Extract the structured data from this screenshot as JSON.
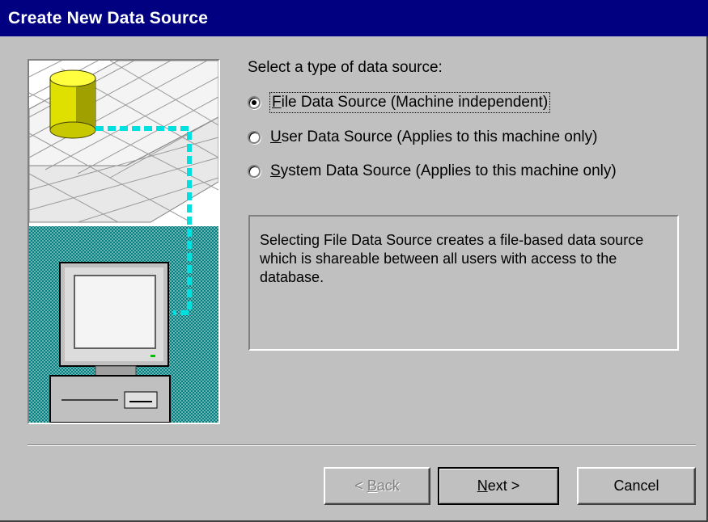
{
  "window": {
    "title": "Create New Data Source"
  },
  "main": {
    "prompt": "Select a type of data source:",
    "options": [
      {
        "accel": "F",
        "rest": "ile Data Source (Machine independent)",
        "checked": true
      },
      {
        "accel": "U",
        "rest": "ser Data Source (Applies to this machine only)",
        "checked": false
      },
      {
        "accel": "S",
        "rest": "ystem Data Source (Applies to this machine only)",
        "checked": false
      }
    ],
    "description": "Selecting File Data Source creates a file-based data source which is shareable between all users with access to the database."
  },
  "buttons": {
    "back": {
      "prefix": "< ",
      "accel": "B",
      "rest": "ack",
      "enabled": false
    },
    "next": {
      "accel": "N",
      "rest": "ext >",
      "enabled": true
    },
    "cancel": {
      "label": "Cancel",
      "enabled": true
    }
  },
  "colors": {
    "titlebar": "#000080",
    "face": "#c0c0c0",
    "teal": "#008080",
    "cyan_link": "#00ffff",
    "cylinder": "#ffff00"
  },
  "icons": {
    "illustration": "database-to-computer-illustration",
    "cylinder": "database-cylinder-icon",
    "computer": "computer-icon"
  }
}
